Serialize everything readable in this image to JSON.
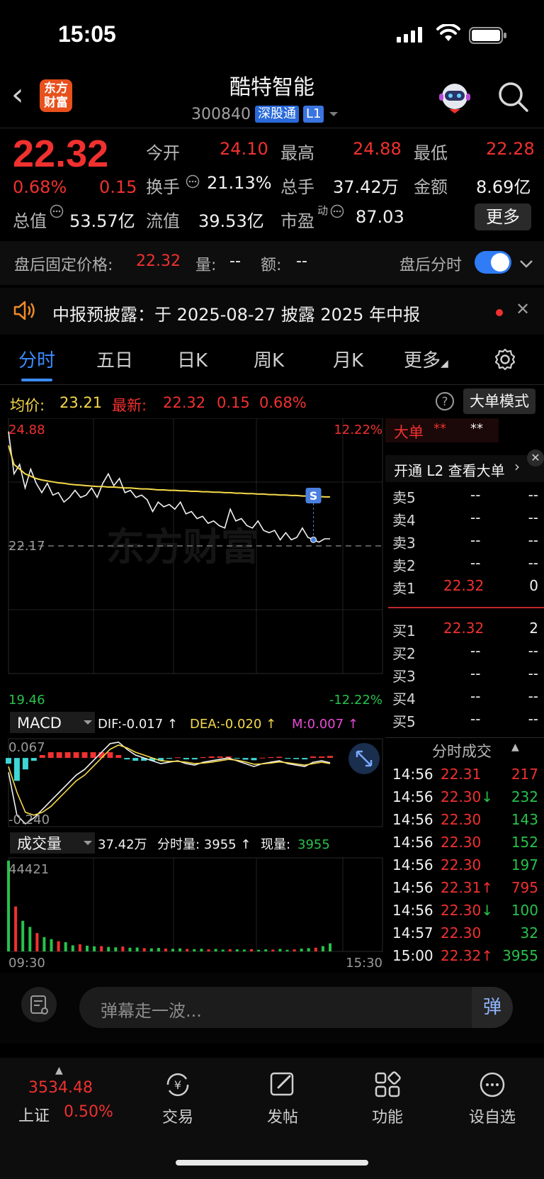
{
  "status_bar": {
    "time": "15:05"
  },
  "header": {
    "logo_text_line1": "东方",
    "logo_text_line2": "财富",
    "stock_name": "酷特智能",
    "stock_code": "300840",
    "market_tag": "深股通",
    "level_tag": "L1"
  },
  "quote": {
    "price": "22.32",
    "change_pct": "0.68%",
    "change": "0.15",
    "open_label": "今开",
    "open": "24.10",
    "high_label": "最高",
    "high": "24.88",
    "low_label": "最低",
    "low": "22.28",
    "turnover_label": "换手",
    "turnover": "21.13%",
    "volume_label": "总手",
    "volume": "37.42万",
    "amount_label": "金额",
    "amount": "8.69亿",
    "mktcap_label": "总值",
    "mktcap": "53.57亿",
    "float_label": "流值",
    "float": "39.53亿",
    "pe_label": "市盈",
    "pe_sup": "动",
    "pe": "87.03",
    "more_button": "更多"
  },
  "after_hours": {
    "label": "盘后固定价格:",
    "price": "22.32",
    "vol_label": "量:",
    "vol": "--",
    "amt_label": "额:",
    "amt": "--",
    "toggle_label": "盘后分时",
    "toggle_on": true
  },
  "notice": {
    "text": "中报预披露：于 2025-08-27 披露 2025 年中报"
  },
  "tabs": [
    {
      "label": "分时",
      "active": true
    },
    {
      "label": "五日"
    },
    {
      "label": "日K"
    },
    {
      "label": "周K"
    },
    {
      "label": "月K"
    },
    {
      "label": "更多"
    }
  ],
  "avg_row": {
    "avg_label": "均价:",
    "avg": "23.21",
    "latest_label": "最新:",
    "latest": "22.32",
    "chg": "0.15",
    "pct": "0.68%",
    "mode_button": "大单模式"
  },
  "chart_data": [
    {
      "type": "line",
      "name": "intraday-price",
      "y_top_label": "24.88",
      "y_bottom_label": "19.46",
      "pct_top_label": "12.22%",
      "pct_bottom_label": "-12.22%",
      "ref_label": "22.17",
      "ylim": [
        19.46,
        24.88
      ],
      "ref": 22.17,
      "watermark": "东方财富",
      "marker_label": "S",
      "price": [
        24.6,
        23.7,
        23.9,
        23.4,
        23.8,
        23.5,
        23.3,
        23.5,
        23.25,
        23.3,
        23.1,
        23.2,
        23.35,
        23.2,
        23.25,
        23.4,
        23.2,
        23.5,
        23.7,
        23.45,
        23.6,
        23.3,
        23.35,
        23.2,
        23.25,
        23.15,
        22.9,
        23.1,
        23.0,
        23.05,
        22.95,
        23.1,
        22.85,
        22.9,
        22.75,
        22.8,
        22.65,
        22.7,
        22.6,
        22.55,
        22.95,
        22.7,
        22.75,
        22.6,
        22.55,
        22.7,
        22.5,
        22.45,
        22.5,
        22.3,
        22.45,
        22.3,
        22.35,
        22.55,
        22.35,
        22.3,
        22.25,
        22.32,
        22.32
      ],
      "avg": [
        24.3,
        23.9,
        23.8,
        23.7,
        23.65,
        23.6,
        23.57,
        23.55,
        23.53,
        23.51,
        23.5,
        23.48,
        23.47,
        23.46,
        23.45,
        23.44,
        23.43,
        23.43,
        23.42,
        23.42,
        23.41,
        23.4,
        23.4,
        23.39,
        23.38,
        23.38,
        23.37,
        23.36,
        23.36,
        23.35,
        23.35,
        23.34,
        23.34,
        23.33,
        23.33,
        23.32,
        23.32,
        23.31,
        23.31,
        23.3,
        23.3,
        23.29,
        23.29,
        23.28,
        23.28,
        23.27,
        23.27,
        23.26,
        23.26,
        23.25,
        23.25,
        23.24,
        23.24,
        23.23,
        23.23,
        23.22,
        23.22,
        23.21,
        23.21
      ]
    },
    {
      "type": "bar",
      "name": "macd",
      "indicator_label": "MACD",
      "dif_label": "DIF:-0.017 ↑",
      "dea_label": "DEA:-0.020 ↑",
      "m_label": "M:0.007 ↑",
      "y_top_label": "0.067",
      "y_bottom_label": "-0.240",
      "ylim": [
        -0.24,
        0.067
      ],
      "dif": [
        -0.05,
        -0.2,
        -0.23,
        -0.21,
        -0.18,
        -0.15,
        -0.12,
        -0.09,
        -0.06,
        -0.04,
        -0.01,
        0.02,
        0.05,
        0.055,
        0.03,
        0.01,
        0.0,
        -0.01,
        -0.02,
        -0.015,
        -0.01,
        -0.02,
        -0.025,
        -0.015,
        -0.01,
        -0.005,
        0.0,
        -0.01,
        -0.02,
        -0.03,
        -0.02,
        -0.015,
        -0.01,
        -0.02,
        -0.025,
        -0.03,
        -0.015,
        -0.01,
        -0.017
      ],
      "dea": [
        -0.03,
        -0.12,
        -0.19,
        -0.2,
        -0.19,
        -0.17,
        -0.14,
        -0.11,
        -0.08,
        -0.06,
        -0.03,
        0.0,
        0.03,
        0.045,
        0.035,
        0.02,
        0.01,
        0.0,
        -0.01,
        -0.012,
        -0.012,
        -0.015,
        -0.02,
        -0.018,
        -0.015,
        -0.01,
        -0.005,
        -0.008,
        -0.014,
        -0.022,
        -0.021,
        -0.018,
        -0.014,
        -0.017,
        -0.021,
        -0.025,
        -0.02,
        -0.015,
        -0.02
      ],
      "hist": [
        -0.02,
        -0.08,
        -0.04,
        -0.01,
        0.01,
        0.02,
        0.02,
        0.02,
        0.02,
        0.02,
        0.02,
        0.02,
        0.02,
        0.01,
        -0.005,
        -0.01,
        -0.01,
        -0.01,
        -0.01,
        -0.003,
        0.002,
        -0.005,
        -0.005,
        0.003,
        0.005,
        0.005,
        0.005,
        -0.002,
        -0.006,
        -0.008,
        0.001,
        0.003,
        0.004,
        -0.003,
        -0.004,
        -0.005,
        0.005,
        0.005,
        0.007
      ]
    },
    {
      "type": "bar",
      "name": "volume",
      "indicator_label": "成交量",
      "total_label": "37.42万",
      "period_label": "分时量: 3955 ↑",
      "now_label": "现量:",
      "now_value": "3955",
      "y_top_label": "44421",
      "x_start": "09:30",
      "x_end": "15:30",
      "ylim": [
        0,
        44421
      ],
      "values": [
        44421,
        22000,
        15000,
        12000,
        9000,
        7000,
        6000,
        5000,
        4500,
        3000,
        3500,
        2800,
        2500,
        2600,
        2200,
        2000,
        2400,
        1800,
        1900,
        1600,
        1500,
        1700,
        1400,
        1300,
        1500,
        1200,
        1100,
        1300,
        1000,
        1200,
        900,
        1100,
        1000,
        900,
        1100,
        800,
        1000,
        900,
        1200,
        800,
        1000,
        1400,
        1600,
        1800,
        2600,
        3955
      ]
    }
  ],
  "order_book": {
    "big_order_label": "大单",
    "big_order_v1": "**",
    "big_order_v2": "**",
    "l2_prompt": "开通 L2 查看大单",
    "asks": [
      {
        "label": "卖5",
        "price": "--",
        "vol": "--"
      },
      {
        "label": "卖4",
        "price": "--",
        "vol": "--"
      },
      {
        "label": "卖3",
        "price": "--",
        "vol": "--"
      },
      {
        "label": "卖2",
        "price": "--",
        "vol": "--"
      },
      {
        "label": "卖1",
        "price": "22.32",
        "vol": "0"
      }
    ],
    "bids": [
      {
        "label": "买1",
        "price": "22.32",
        "vol": "2"
      },
      {
        "label": "买2",
        "price": "--",
        "vol": "--"
      },
      {
        "label": "买3",
        "price": "--",
        "vol": "--"
      },
      {
        "label": "买4",
        "price": "--",
        "vol": "--"
      },
      {
        "label": "买5",
        "price": "--",
        "vol": "--"
      }
    ]
  },
  "trades": {
    "title": "分时成交",
    "rows": [
      {
        "time": "14:56",
        "price": "22.31",
        "arrow": "",
        "vol": "217",
        "vol_color": "red"
      },
      {
        "time": "14:56",
        "price": "22.30",
        "arrow": "↓",
        "vol": "232",
        "vol_color": "green"
      },
      {
        "time": "14:56",
        "price": "22.30",
        "arrow": "",
        "vol": "143",
        "vol_color": "green"
      },
      {
        "time": "14:56",
        "price": "22.30",
        "arrow": "",
        "vol": "152",
        "vol_color": "green"
      },
      {
        "time": "14:56",
        "price": "22.30",
        "arrow": "",
        "vol": "197",
        "vol_color": "green"
      },
      {
        "time": "14:56",
        "price": "22.31",
        "arrow": "↑",
        "vol": "795",
        "vol_color": "red"
      },
      {
        "time": "14:56",
        "price": "22.30",
        "arrow": "↓",
        "vol": "100",
        "vol_color": "green"
      },
      {
        "time": "14:57",
        "price": "22.30",
        "arrow": "",
        "vol": "32",
        "vol_color": "green"
      },
      {
        "time": "15:00",
        "price": "22.32",
        "arrow": "↑",
        "vol": "3955",
        "vol_color": "green"
      }
    ]
  },
  "comment_bar": {
    "placeholder": "弹幕走一波...",
    "send": "弹"
  },
  "bottom_nav": {
    "index_value": "3534.48",
    "index_name": "上证",
    "index_pct": "0.50%",
    "items": [
      {
        "label": "交易"
      },
      {
        "label": "发帖"
      },
      {
        "label": "功能"
      },
      {
        "label": "设自选"
      }
    ]
  },
  "colors": {
    "up": "#f0312f",
    "down": "#27c24c",
    "avg_line": "#f5d94b",
    "accent": "#3b8cff"
  }
}
